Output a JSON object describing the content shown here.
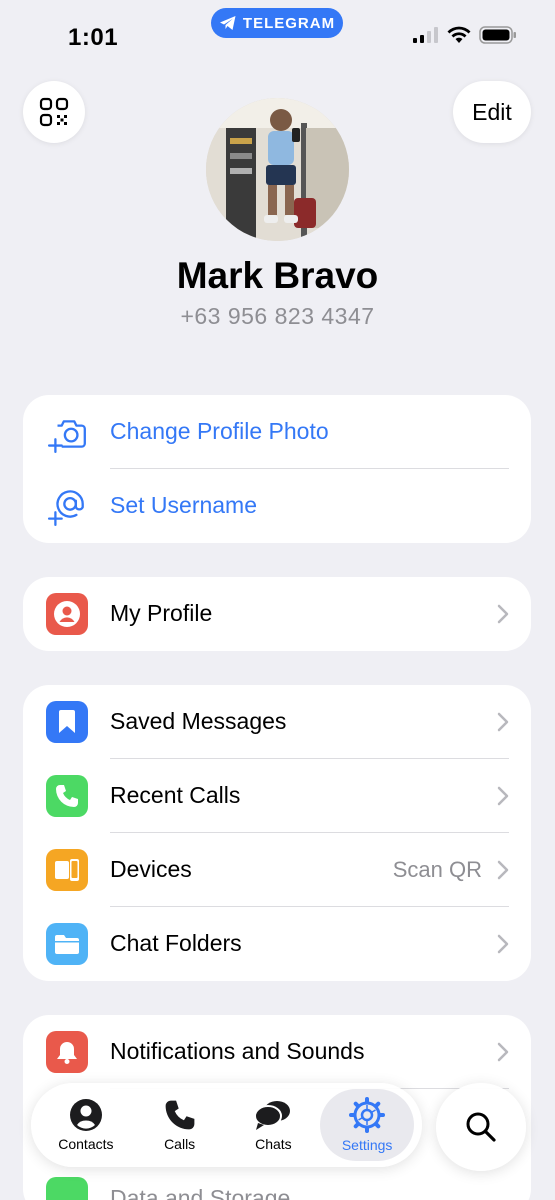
{
  "status": {
    "time": "1:01",
    "app_label": "TELEGRAM"
  },
  "header": {
    "edit_label": "Edit",
    "name": "Mark Bravo",
    "phone": "+63 956 823 4347"
  },
  "account_actions": [
    {
      "label": "Change Profile Photo",
      "icon": "camera-add-icon"
    },
    {
      "label": "Set Username",
      "icon": "at-sign-icon"
    }
  ],
  "profile_group": [
    {
      "label": "My Profile",
      "icon": "person-icon",
      "color": "#e9594b"
    }
  ],
  "main_group": [
    {
      "label": "Saved Messages",
      "icon": "bookmark-icon",
      "color": "#3478f6"
    },
    {
      "label": "Recent Calls",
      "icon": "phone-icon",
      "color": "#4cd964"
    },
    {
      "label": "Devices",
      "icon": "devices-icon",
      "color": "#f5a623",
      "value": "Scan QR"
    },
    {
      "label": "Chat Folders",
      "icon": "folder-icon",
      "color": "#4fb3f6"
    }
  ],
  "settings_group": [
    {
      "label": "Notifications and Sounds",
      "icon": "bell-icon",
      "color": "#e9594b"
    },
    {
      "label": "Data and Storage",
      "icon": "storage-icon",
      "color": "#4cd964"
    }
  ],
  "tabs": [
    {
      "label": "Contacts",
      "icon": "person-circle-icon"
    },
    {
      "label": "Calls",
      "icon": "phone-icon"
    },
    {
      "label": "Chats",
      "icon": "chat-bubbles-icon"
    },
    {
      "label": "Settings",
      "icon": "gear-icon",
      "active": true
    }
  ],
  "colors": {
    "accent": "#3478f6",
    "background": "#efeff4",
    "secondary_text": "#8e8e93"
  }
}
